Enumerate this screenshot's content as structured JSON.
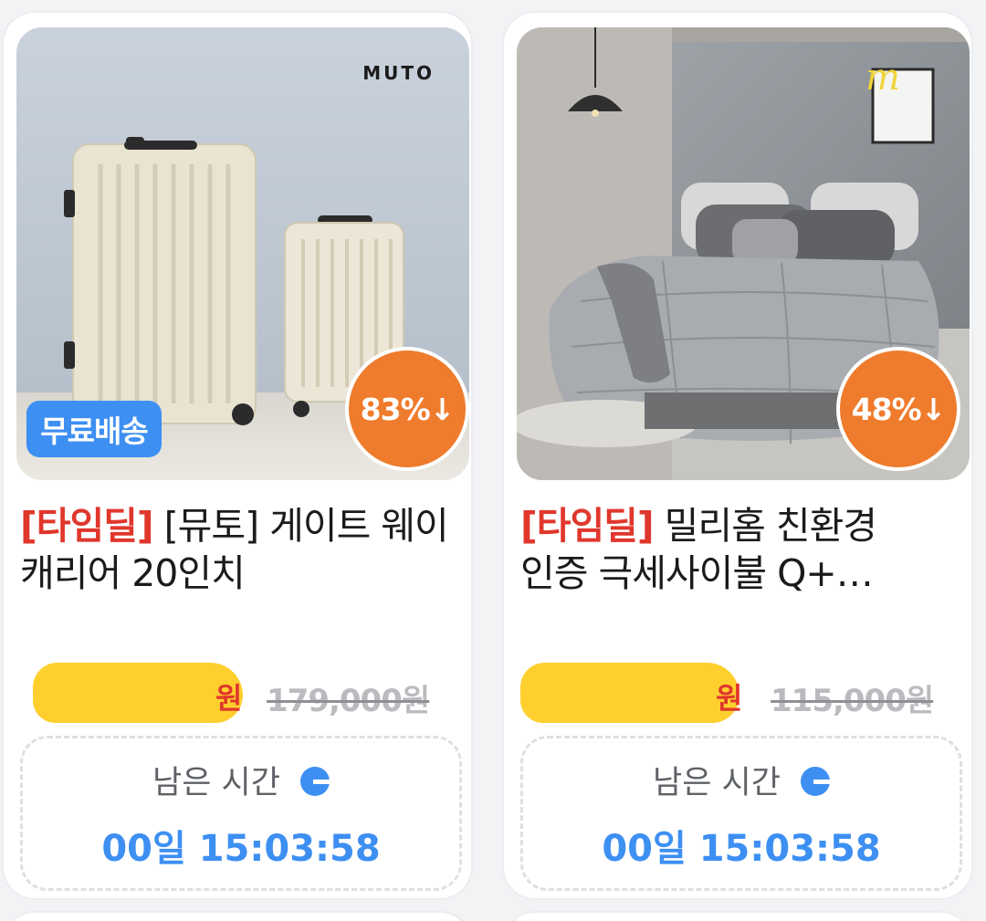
{
  "products": [
    {
      "brand_logo": "MUTO",
      "free_shipping_badge": "무료배송",
      "discount": "83%↓",
      "deal_tag": "[타임딜]",
      "title_rest": " [뮤토] 게이트 웨이 캐리어 20인치",
      "sale_unit": "원",
      "original_price": "179,000원",
      "timer_label": "남은 시간",
      "timer_value": "00일 15:03:58"
    },
    {
      "discount": "48%↓",
      "deal_tag": "[타임딜]",
      "title_rest": " 밀리홈 친환경 인증 극세사이불 Q+…",
      "sale_unit": "원",
      "original_price": "115,000원",
      "timer_label": "남은 시간",
      "timer_value": "00일 15:03:58"
    }
  ],
  "colors": {
    "deal_red": "#e0372d",
    "accent_blue": "#3d8ff2",
    "discount_orange": "#ef7b2c",
    "redaction_yellow": "#ffcf2e"
  }
}
